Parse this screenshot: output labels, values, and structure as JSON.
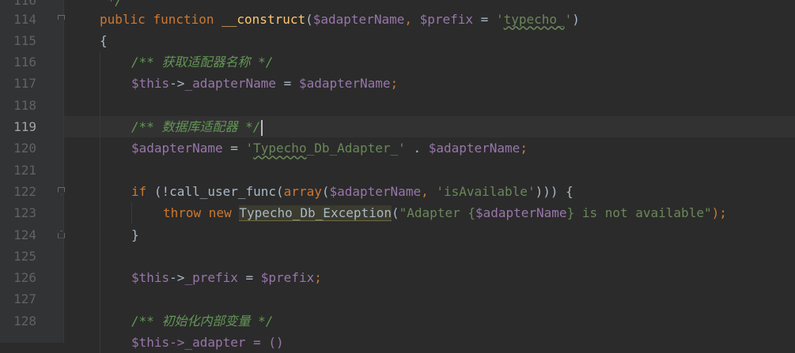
{
  "editor": {
    "language": "PHP",
    "current_line": 119,
    "lines": [
      {
        "num": "116",
        "top_text": "*/"
      },
      {
        "num": "114"
      },
      {
        "num": "115"
      },
      {
        "num": "116"
      },
      {
        "num": "117"
      },
      {
        "num": "118"
      },
      {
        "num": "119"
      },
      {
        "num": "120"
      },
      {
        "num": "121"
      },
      {
        "num": "122"
      },
      {
        "num": "123"
      },
      {
        "num": "124"
      },
      {
        "num": "125"
      },
      {
        "num": "126"
      },
      {
        "num": "127"
      },
      {
        "num": "128"
      }
    ],
    "tokens": {
      "l0_cmt": " */",
      "l114_public": "public",
      "l114_function": "function",
      "l114_name": "__construct",
      "l114_p1": "(",
      "l114_v1": "$adapterName",
      "l114_c1": ", ",
      "l114_v2": "$prefix",
      "l114_eq": " = ",
      "l114_q1": "'",
      "l114_s1": "typecho_",
      "l114_q2": "'",
      "l114_p2": ")",
      "l115_brace": "{",
      "l116_cmt": "/** 获取适配器名称 */",
      "l117_this": "$this",
      "l117_arrow": "->",
      "l117_prop": "_adapterName",
      "l117_eq": " = ",
      "l117_var": "$adapterName",
      "l117_semi": ";",
      "l119_cmt": "/** 数据库适配器 */",
      "l120_var": "$adapterName",
      "l120_eq": " = ",
      "l120_q1": "'",
      "l120_s1": "Typecho",
      "l120_s2": "_Db_Adapter_",
      "l120_q2": "'",
      "l120_dot": " . ",
      "l120_var2": "$adapterName",
      "l120_semi": ";",
      "l122_if": "if",
      "l122_p1": " (!",
      "l122_fn": "call_user_func",
      "l122_p2": "(",
      "l122_arr": "array",
      "l122_p3": "(",
      "l122_var": "$adapterName",
      "l122_c1": ", ",
      "l122_str": "'isAvailable'",
      "l122_p4": "))) {",
      "l123_throw": "throw",
      "l123_new": " new ",
      "l123_cls": "Typecho_Db_Exception",
      "l123_p1": "(",
      "l123_s1": "\"Adapter {",
      "l123_var": "$adapterName",
      "l123_s2": "} is not available\"",
      "l123_p2": ");",
      "l124_brace": "}",
      "l126_this": "$this",
      "l126_arrow": "->",
      "l126_prop": "_prefix",
      "l126_eq": " = ",
      "l126_var": "$prefix",
      "l126_semi": ";",
      "l128_cmt": "/** 初始化内部变量 */",
      "l129_partial": "$this->_adapter = ()"
    }
  }
}
